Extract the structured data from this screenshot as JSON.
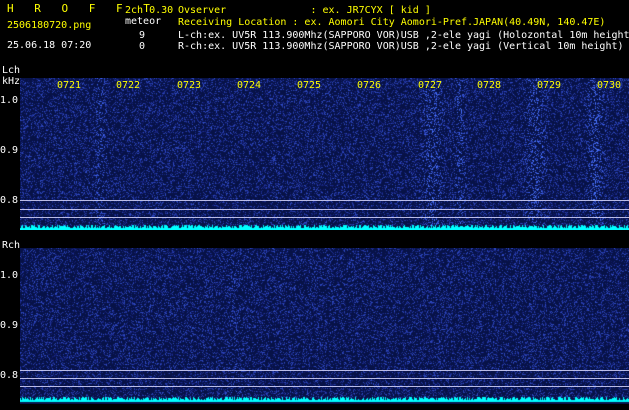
{
  "brand": "H R O F F T",
  "filename": "2506180720.png",
  "datetime": "25.06.18 07:20",
  "mode": "2ch 0.30",
  "meteor_label": "meteor",
  "count_l": "9",
  "count_r": "0",
  "info": {
    "observer": "Ovserver              : ex. JR7CYX [ kid ]",
    "location": "Receiving Location : ex. Aomori City Aomori-Pref.JAPAN(40.49N, 140.47E)",
    "lch": "L-ch:ex. UV5R 113.900Mhz(SAPPORO VOR)USB ,2-ele yagi (Holozontal 10m height)",
    "rch": "R-ch:ex. UV5R 113.900Mhz(SAPPORO VOR)USB ,2-ele yagi (Vertical 10m height)"
  },
  "top_panel": {
    "channel": "Lch",
    "unit": "kHz",
    "ticks": [
      "1.0",
      "0.9",
      "0.8"
    ],
    "hours": [
      "0721",
      "0722",
      "0723",
      "0724",
      "0725",
      "0726",
      "0727",
      "0728",
      "0729",
      "0730"
    ]
  },
  "bottom_panel": {
    "channel": "Rch",
    "ticks": [
      "1.0",
      "0.9",
      "0.8"
    ]
  },
  "colors": {
    "background": "#000000",
    "spectrum": "#071247",
    "noise_floor": "#00ffff",
    "label": "#ffff00"
  }
}
